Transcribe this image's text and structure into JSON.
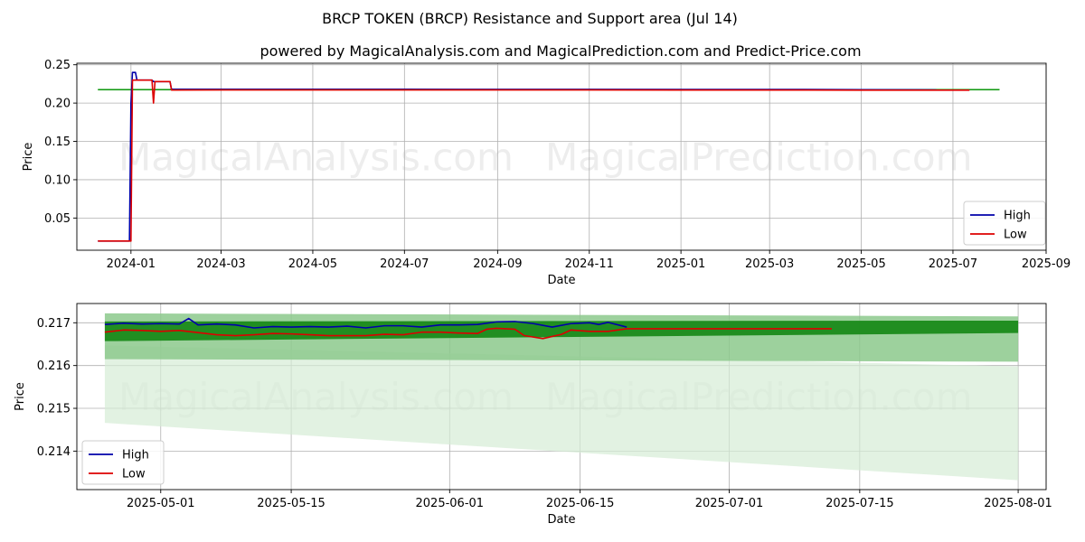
{
  "figure": {
    "title": "BRCP TOKEN (BRCP) Resistance and Support area (Jul 14)",
    "subtitle": "powered by MagicalAnalysis.com and MagicalPrediction.com and Predict-Price.com",
    "watermarks": [
      "MagicalAnalysis.com",
      "MagicalPrediction.com"
    ]
  },
  "colors": {
    "high": "#0000aa",
    "low": "#dd0000",
    "band_dark": "#1a8a1a",
    "band_light": "#8cc98c",
    "band_faint": "#d6ecd6",
    "grid": "#b0b0b0"
  },
  "chart_data": [
    {
      "type": "line",
      "xlabel": "Date",
      "ylabel": "Price",
      "ylim": [
        0.008,
        0.252
      ],
      "xlim": [
        "2023-11-26",
        "2025-09-01"
      ],
      "x_ticks": [
        "2024-01",
        "2024-03",
        "2024-05",
        "2024-07",
        "2024-09",
        "2024-11",
        "2025-01",
        "2025-03",
        "2025-05",
        "2025-07",
        "2025-09"
      ],
      "y_ticks": [
        0.05,
        0.1,
        0.15,
        0.2,
        0.25
      ],
      "y_tick_labels": [
        "0.05",
        "0.10",
        "0.15",
        "0.20",
        "0.25"
      ],
      "legend": {
        "position": "bottom-right",
        "entries": [
          "High",
          "Low"
        ]
      },
      "grid": true,
      "support_line": {
        "x": [
          "2023-12-10",
          "2025-08-01"
        ],
        "y": [
          0.2175,
          0.2175
        ]
      },
      "band": {
        "x": [
          "2023-12-10",
          "2025-08-01"
        ],
        "upper": [
          0.2185,
          0.2185
        ],
        "lower": [
          0.2165,
          0.2165
        ]
      },
      "series": [
        {
          "name": "High",
          "x": [
            "2023-12-10",
            "2023-12-31",
            "2024-01-01",
            "2024-01-02",
            "2024-01-04",
            "2024-01-05",
            "2024-01-15",
            "2024-01-16",
            "2024-01-27",
            "2024-01-28",
            "2024-03-01",
            "2024-05-01",
            "2024-07-01",
            "2024-09-01",
            "2024-11-01",
            "2025-01-01",
            "2025-03-01",
            "2025-05-01",
            "2025-06-20"
          ],
          "y": [
            0.02,
            0.02,
            0.2,
            0.24,
            0.24,
            0.23,
            0.23,
            0.228,
            0.228,
            0.218,
            0.218,
            0.218,
            0.218,
            0.2179,
            0.2179,
            0.2178,
            0.2178,
            0.2175,
            0.2172
          ]
        },
        {
          "name": "Low",
          "x": [
            "2023-12-10",
            "2024-01-01",
            "2024-01-02",
            "2024-01-15",
            "2024-01-16",
            "2024-01-17",
            "2024-01-27",
            "2024-01-28",
            "2024-03-01",
            "2024-05-01",
            "2024-07-01",
            "2024-09-01",
            "2024-11-01",
            "2025-01-01",
            "2025-03-01",
            "2025-05-01",
            "2025-07-12"
          ],
          "y": [
            0.02,
            0.02,
            0.23,
            0.23,
            0.2,
            0.228,
            0.228,
            0.217,
            0.2172,
            0.2172,
            0.2172,
            0.2172,
            0.2171,
            0.217,
            0.217,
            0.2169,
            0.2168
          ]
        }
      ]
    },
    {
      "type": "line",
      "xlabel": "Date",
      "ylabel": "Price",
      "ylim": [
        0.2131,
        0.21745
      ],
      "xlim": [
        "2025-04-22",
        "2025-08-04"
      ],
      "x_ticks": [
        "2025-05-01",
        "2025-05-15",
        "2025-06-01",
        "2025-06-15",
        "2025-07-01",
        "2025-07-15",
        "2025-08-01"
      ],
      "y_ticks": [
        0.214,
        0.215,
        0.216,
        0.217
      ],
      "y_tick_labels": [
        "0.214",
        "0.215",
        "0.216",
        "0.217"
      ],
      "legend": {
        "position": "bottom-left",
        "entries": [
          "High",
          "Low"
        ]
      },
      "grid": true,
      "bands": [
        {
          "x": [
            "2025-04-25",
            "2025-08-01"
          ],
          "upper": [
            0.21647,
            0.21598
          ],
          "lower": [
            0.21466,
            0.21332
          ],
          "level": "faint"
        },
        {
          "x": [
            "2025-04-25",
            "2025-08-01"
          ],
          "upper": [
            0.21722,
            0.21715
          ],
          "lower": [
            0.21615,
            0.21609
          ],
          "level": "light"
        },
        {
          "x": [
            "2025-04-25",
            "2025-08-01"
          ],
          "upper": [
            0.21703,
            0.21705
          ],
          "lower": [
            0.21657,
            0.21676
          ],
          "level": "dark"
        }
      ],
      "series": [
        {
          "name": "High",
          "x": [
            "2025-04-25",
            "2025-04-27",
            "2025-04-29",
            "2025-05-01",
            "2025-05-03",
            "2025-05-04",
            "2025-05-05",
            "2025-05-07",
            "2025-05-09",
            "2025-05-11",
            "2025-05-13",
            "2025-05-15",
            "2025-05-17",
            "2025-05-19",
            "2025-05-21",
            "2025-05-23",
            "2025-05-25",
            "2025-05-27",
            "2025-05-29",
            "2025-05-31",
            "2025-06-02",
            "2025-06-04",
            "2025-06-06",
            "2025-06-08",
            "2025-06-10",
            "2025-06-12",
            "2025-06-14",
            "2025-06-16",
            "2025-06-17",
            "2025-06-18",
            "2025-06-20"
          ],
          "y": [
            0.21696,
            0.21699,
            0.21697,
            0.21698,
            0.21697,
            0.2171,
            0.21695,
            0.21697,
            0.21695,
            0.21688,
            0.21691,
            0.2169,
            0.21691,
            0.2169,
            0.21692,
            0.21688,
            0.21693,
            0.21693,
            0.2169,
            0.21695,
            0.21695,
            0.21696,
            0.21702,
            0.21703,
            0.21698,
            0.2169,
            0.21698,
            0.217,
            0.21696,
            0.21701,
            0.2169
          ]
        },
        {
          "name": "Low",
          "x": [
            "2025-04-25",
            "2025-04-27",
            "2025-04-29",
            "2025-05-01",
            "2025-05-03",
            "2025-05-05",
            "2025-05-07",
            "2025-05-09",
            "2025-05-11",
            "2025-05-13",
            "2025-05-15",
            "2025-05-17",
            "2025-05-19",
            "2025-05-21",
            "2025-05-23",
            "2025-05-25",
            "2025-05-27",
            "2025-05-29",
            "2025-05-31",
            "2025-06-02",
            "2025-06-04",
            "2025-06-05",
            "2025-06-06",
            "2025-06-08",
            "2025-06-09",
            "2025-06-11",
            "2025-06-13",
            "2025-06-14",
            "2025-06-16",
            "2025-06-18",
            "2025-06-20",
            "2025-07-12"
          ],
          "y": [
            0.21678,
            0.21683,
            0.21682,
            0.2168,
            0.21682,
            0.21677,
            0.21672,
            0.2167,
            0.21672,
            0.21675,
            0.21674,
            0.21672,
            0.2167,
            0.2167,
            0.2167,
            0.21673,
            0.21672,
            0.21678,
            0.21678,
            0.21676,
            0.21675,
            0.21685,
            0.21687,
            0.21685,
            0.2167,
            0.21663,
            0.21673,
            0.21683,
            0.2168,
            0.2168,
            0.21686,
            0.21686
          ]
        }
      ]
    }
  ]
}
